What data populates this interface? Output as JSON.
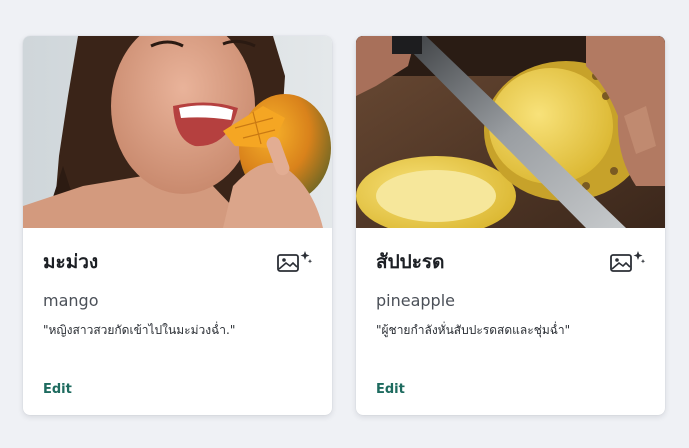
{
  "cards": [
    {
      "title": "มะม่วง",
      "subtitle": "mango",
      "caption": "\"หญิงสาวสวยกัดเข้าไปในมะม่วงฉ่ำ.\"",
      "edit_label": "Edit",
      "image_icon": "image-sparkle-icon"
    },
    {
      "title": "สัปปะรด",
      "subtitle": "pineapple",
      "caption": "\"ผู้ชายกำลังหั่นสับปะรดสดและชุ่มฉ่ำ\"",
      "edit_label": "Edit",
      "image_icon": "image-sparkle-icon"
    }
  ],
  "colors": {
    "page_background": "#eff1f5",
    "card_background": "#ffffff",
    "edit_link": "#1e6b5f",
    "title_text": "#1c1f24"
  }
}
